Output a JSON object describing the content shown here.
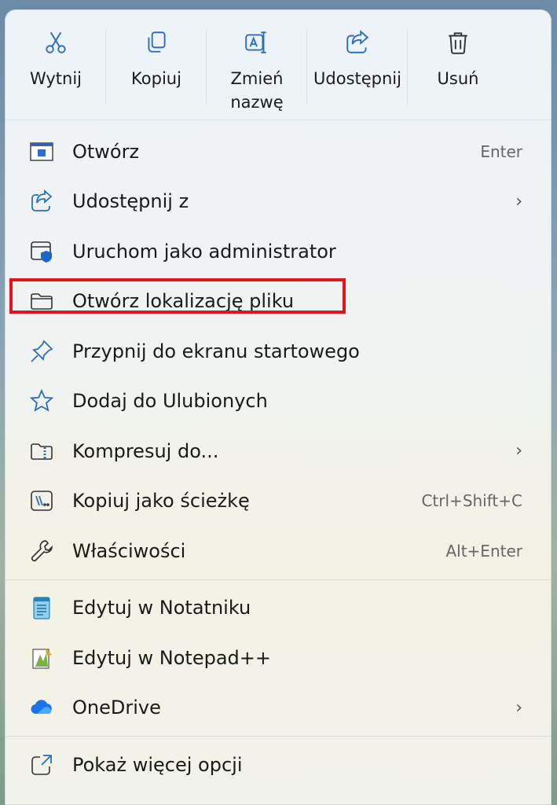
{
  "toolbar": {
    "cut": "Wytnij",
    "copy": "Kopiuj",
    "rename": "Zmień nazwę",
    "share": "Udostępnij",
    "delete": "Usuń"
  },
  "items": [
    {
      "label": "Otwórz",
      "shortcut": "Enter",
      "icon": "open-app-icon"
    },
    {
      "label": "Udostępnij z",
      "icon": "share-icon",
      "chevron": "›"
    },
    {
      "label": "Uruchom jako administrator",
      "icon": "shield-window-icon"
    },
    {
      "label": "Otwórz lokalizację pliku",
      "icon": "folder-icon"
    },
    {
      "label": "Przypnij do ekranu startowego",
      "icon": "pin-icon"
    },
    {
      "label": "Dodaj do Ulubionych",
      "icon": "star-icon"
    },
    {
      "label": "Kompresuj do...",
      "icon": "zip-folder-icon",
      "chevron": "›"
    },
    {
      "label": "Kopiuj jako ścieżkę",
      "shortcut": "Ctrl+Shift+C",
      "icon": "copy-path-icon"
    },
    {
      "label": "Właściwości",
      "shortcut": "Alt+Enter",
      "icon": "wrench-icon"
    }
  ],
  "apps": [
    {
      "label": "Edytuj w Notatniku",
      "icon": "notepad-icon"
    },
    {
      "label": "Edytuj w Notepad++",
      "icon": "notepadpp-icon"
    },
    {
      "label": "OneDrive",
      "icon": "onedrive-icon",
      "chevron": "›"
    }
  ],
  "more": {
    "label": "Pokaż więcej opcji",
    "icon": "more-options-icon"
  },
  "colors": {
    "accent": "#0067c0",
    "highlight": "#e3151b"
  }
}
